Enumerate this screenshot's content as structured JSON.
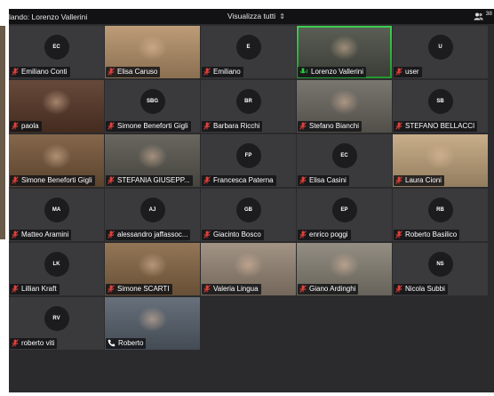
{
  "topbar": {
    "speaking": "lando: Lorenzo Vallerini",
    "view_mode": "Visualizza tutti",
    "participant_count": "38"
  },
  "participants": [
    {
      "name": "Emiliano Conti",
      "initials": "EC",
      "mic": "muted",
      "bg": "#3a3a3c"
    },
    {
      "name": "Elisa Caruso",
      "initials": "",
      "mic": "muted",
      "bg": "#b8946c"
    },
    {
      "name": "Emiliano",
      "initials": "E",
      "mic": "muted",
      "bg": "#3a3a3c"
    },
    {
      "name": "Lorenzo Vallerini",
      "initials": "",
      "mic": "on",
      "bg": "#4e5148"
    },
    {
      "name": "user",
      "initials": "U",
      "mic": "muted",
      "bg": "#3a3a3c"
    },
    {
      "name": "paola",
      "initials": "",
      "mic": "muted",
      "bg": "#5a3a2a"
    },
    {
      "name": "Simone Beneforti Gigli",
      "initials": "SBG",
      "mic": "muted",
      "bg": "#3a3a3c"
    },
    {
      "name": "Barbara Ricchi",
      "initials": "BR",
      "mic": "muted",
      "bg": "#3a3a3c"
    },
    {
      "name": "Stefano Bianchi",
      "initials": "",
      "mic": "muted",
      "bg": "#6e6a63"
    },
    {
      "name": "STEFANO BELLACCI",
      "initials": "SB",
      "mic": "muted",
      "bg": "#3a3a3c"
    },
    {
      "name": "Simone Beneforti Gigli",
      "initials": "",
      "mic": "muted",
      "bg": "#7a5a3c"
    },
    {
      "name": "STEFANIA GIUSEPP...",
      "initials": "",
      "mic": "muted",
      "bg": "#5c5a52"
    },
    {
      "name": "Francesca Paterna",
      "initials": "FP",
      "mic": "muted",
      "bg": "#3a3a3c"
    },
    {
      "name": "Elisa Casini",
      "initials": "EC",
      "mic": "muted",
      "bg": "#3a3a3c"
    },
    {
      "name": "Laura Cioni",
      "initials": "",
      "mic": "muted",
      "bg": "#c4a77f"
    },
    {
      "name": "Matteo Aramini",
      "initials": "MA",
      "mic": "muted",
      "bg": "#3a3a3c"
    },
    {
      "name": "alessandro jaffassoc...",
      "initials": "AJ",
      "mic": "muted",
      "bg": "#3a3a3c"
    },
    {
      "name": "Giacinto Bosco",
      "initials": "GB",
      "mic": "muted",
      "bg": "#3a3a3c"
    },
    {
      "name": "enrico poggi",
      "initials": "EP",
      "mic": "muted",
      "bg": "#3a3a3c"
    },
    {
      "name": "Roberto Basilico",
      "initials": "RB",
      "mic": "muted",
      "bg": "#3a3a3c"
    },
    {
      "name": "Lillian Kraft",
      "initials": "LK",
      "mic": "muted",
      "bg": "#3a3a3c"
    },
    {
      "name": "Simone SCARTI",
      "initials": "",
      "mic": "muted",
      "bg": "#8a6a48"
    },
    {
      "name": "Valeria Lingua",
      "initials": "",
      "mic": "muted",
      "bg": "#9a8a7a"
    },
    {
      "name": "Giano Ardinghi",
      "initials": "",
      "mic": "muted",
      "bg": "#8a8478"
    },
    {
      "name": "Nicola Subbi",
      "initials": "NS",
      "mic": "muted",
      "bg": "#3a3a3c"
    },
    {
      "name": "roberto viti",
      "initials": "RV",
      "mic": "muted",
      "bg": "#3a3a3c"
    },
    {
      "name": "Roberto",
      "initials": "",
      "mic": "phone",
      "bg": "#5a6470"
    }
  ],
  "colors": {
    "muted_icon": "#e0413a",
    "active_border": "#2ecc40",
    "tile_bg": "#3a3a3c",
    "topbar_bg": "#121214"
  }
}
